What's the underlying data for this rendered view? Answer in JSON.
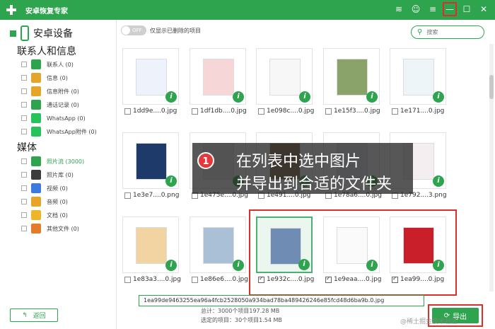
{
  "app": {
    "title": "安卓恢复专家",
    "colors": {
      "brand": "#2ea44f",
      "highlight": "#d9302c"
    }
  },
  "titlebar_icons": [
    "wifi-icon",
    "chat-icon",
    "menu-icon",
    "minimize-icon",
    "maximize-icon",
    "close-icon"
  ],
  "sidebar": {
    "device": "安卓设备",
    "sections": [
      {
        "title": "联系人和信息",
        "items": [
          {
            "label": "联系人 (0)",
            "icon": "contacts-icon",
            "color": "#2ea44f"
          },
          {
            "label": "信息 (0)",
            "icon": "message-icon",
            "color": "#e5a52b"
          },
          {
            "label": "信息附件 (0)",
            "icon": "attachment-icon",
            "color": "#e5a52b"
          },
          {
            "label": "通话记录 (0)",
            "icon": "call-log-icon",
            "color": "#2ea44f"
          },
          {
            "label": "WhatsApp (0)",
            "icon": "whatsapp-icon",
            "color": "#25c35a"
          },
          {
            "label": "WhatsApp附件 (0)",
            "icon": "whatsapp-attachment-icon",
            "color": "#25c35a"
          }
        ]
      },
      {
        "title": "媒体",
        "items": [
          {
            "label": "照片流 (3000)",
            "icon": "photo-stream-icon",
            "color": "#2ea44f"
          },
          {
            "label": "照片库 (0)",
            "icon": "photo-library-icon",
            "color": "#3c3c3c"
          },
          {
            "label": "视频 (0)",
            "icon": "video-icon",
            "color": "#3b7be0"
          },
          {
            "label": "音频 (0)",
            "icon": "audio-icon",
            "color": "#e5a52b"
          },
          {
            "label": "文档 (0)",
            "icon": "document-icon",
            "color": "#f0b429"
          },
          {
            "label": "其他文件 (0)",
            "icon": "other-files-icon",
            "color": "#e57a2b"
          }
        ]
      }
    ],
    "back_label": "返回"
  },
  "toolbar": {
    "toggle_label": "OFF",
    "show_deleted_label": "仅显示已删除的项目",
    "search_placeholder": "搜索"
  },
  "grid": {
    "rows": [
      [
        {
          "name": "1dd9e....0.jpg",
          "checked": false,
          "selected": false
        },
        {
          "name": "1df1db....0.jpg",
          "checked": false,
          "selected": false
        },
        {
          "name": "1e098c....0.jpg",
          "checked": false,
          "selected": false
        },
        {
          "name": "1e15f3....0.jpg",
          "checked": false,
          "selected": false
        },
        {
          "name": "1e171....0.jpg",
          "checked": false,
          "selected": false
        }
      ],
      [
        {
          "name": "1e3e7....0.png",
          "checked": false,
          "selected": false
        },
        {
          "name": "1e475e....0.jpg",
          "checked": false,
          "selected": false
        },
        {
          "name": "1e491....0.jpg",
          "checked": false,
          "selected": false
        },
        {
          "name": "1e78a6....0.jpg",
          "checked": false,
          "selected": false
        },
        {
          "name": "1e792....3.png",
          "checked": false,
          "selected": false
        }
      ],
      [
        {
          "name": "1e83a3....0.jpg",
          "checked": false,
          "selected": false
        },
        {
          "name": "1e86e6....0.jpg",
          "checked": false,
          "selected": false
        },
        {
          "name": "1e932c....0.jpg",
          "checked": true,
          "selected": true
        },
        {
          "name": "1e9eaa....0.jpg",
          "checked": true,
          "selected": false
        },
        {
          "name": "1ea99....0.jpg",
          "checked": true,
          "selected": false
        }
      ]
    ]
  },
  "tooltip": "1ea99de9463255ea96a4fcb2528050a934bad78ba489426246e85fcd48d6ba9b.0.jpg",
  "status": {
    "total": "总计：3000个项目197.28 MB",
    "selected": "选定的项目：30个项目1.54 MB"
  },
  "export_label": "导出",
  "overlay": {
    "step": "1",
    "line1": "在列表中选中图片",
    "line2": "并导出到合适的文件夹"
  },
  "watermark": "@稀土掘金技术社区"
}
